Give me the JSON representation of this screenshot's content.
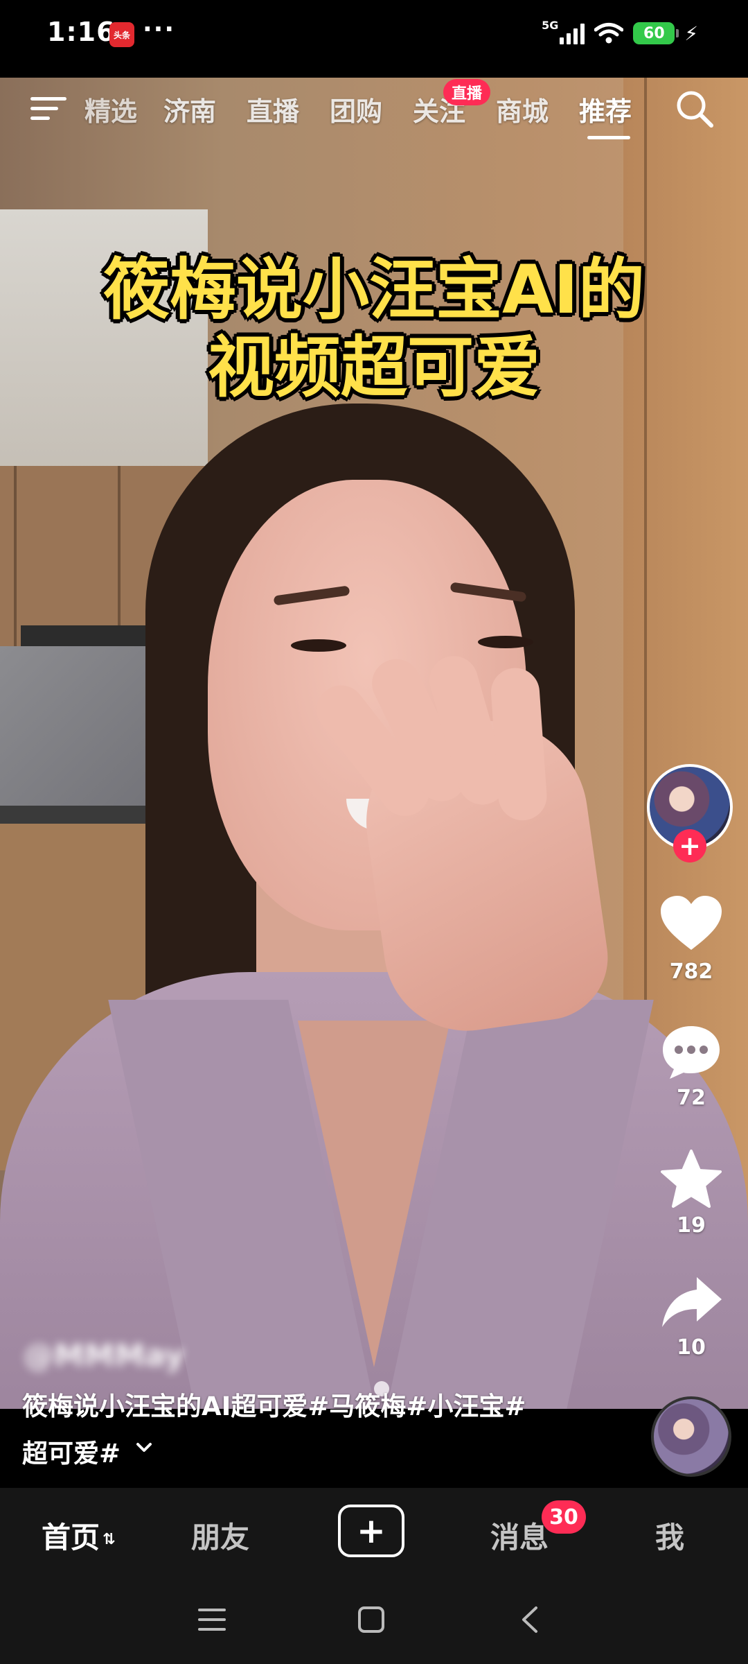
{
  "status_bar": {
    "time": "1:16",
    "app_icon_label": "头条",
    "more": "···",
    "network": "5G",
    "battery": "60",
    "icons": [
      "signal-icon",
      "wifi-icon",
      "battery-icon",
      "charging-icon"
    ]
  },
  "top_nav": {
    "menu_icon": "menu-icon",
    "tabs": [
      {
        "label": "精选",
        "active": false
      },
      {
        "label": "济南",
        "active": false
      },
      {
        "label": "直播",
        "active": false
      },
      {
        "label": "团购",
        "active": false
      },
      {
        "label": "关注",
        "active": false,
        "badge": "直播"
      },
      {
        "label": "商城",
        "active": false
      },
      {
        "label": "推荐",
        "active": true
      }
    ],
    "search_icon": "search-icon"
  },
  "video": {
    "title_line_1": "筱梅说小汪宝AI的",
    "title_line_2": "视频超可爱"
  },
  "actions": {
    "likes": "782",
    "comments": "72",
    "favorites": "19",
    "shares": "10",
    "follow": "+"
  },
  "caption": {
    "author": "@MMMay",
    "line_1": "筱梅说小汪宝的AI超可爱#马筱梅#小汪宝#",
    "line_2": "超可爱#"
  },
  "bottom_tabs": {
    "home": "首页",
    "home_switch": "⇅",
    "friends": "朋友",
    "create": "+",
    "messages": "消息",
    "messages_badge": "30",
    "me": "我"
  },
  "colors": {
    "accent": "#fe2c55",
    "title_yellow": "#ffe14a",
    "tab_bar": "#161616"
  }
}
